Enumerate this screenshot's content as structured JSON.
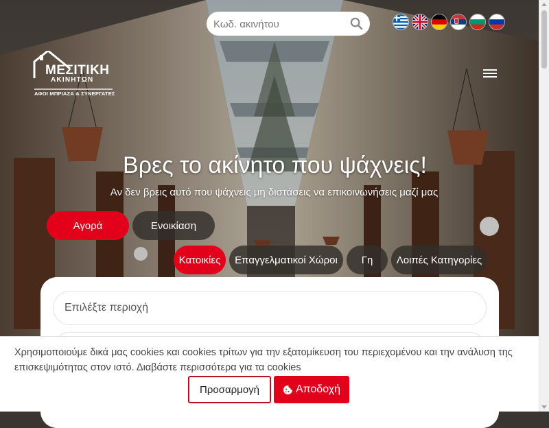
{
  "search": {
    "placeholder": "Κωδ. ακινήτου"
  },
  "languages": [
    {
      "name": "greek-flag-icon"
    },
    {
      "name": "uk-flag-icon"
    },
    {
      "name": "german-flag-icon"
    },
    {
      "name": "serbian-flag-icon"
    },
    {
      "name": "bulgarian-flag-icon"
    },
    {
      "name": "russian-flag-icon"
    }
  ],
  "logo": {
    "line1": "ΜΕΣΙΤΙΚΗ",
    "line2": "ΑΚΙΝΗΤΩΝ",
    "line3": "ΑΦΟΙ ΜΠΡΙΑΖΑ & ΣΥΝΕΡΓΑΤΕΣ"
  },
  "hero": {
    "title": "Βρες το ακίνητο που ψάχνεις!",
    "subtitle": "Αν δεν βρεις αυτό που ψάχνεις μη διστάσεις να επικοινωνήσεις μαζί μας"
  },
  "tabs": {
    "buy": "Αγορά",
    "rent": "Ενοικίαση"
  },
  "categories": {
    "homes": "Κατοικίες",
    "professional": "Επαγγελματικοί Χώροι",
    "land": "Γη",
    "other": "Λοιπές Κατηγορίες"
  },
  "filter": {
    "area_placeholder": "Επιλέξτε περιοχή"
  },
  "cookie": {
    "text": "Χρησιμοποιούμε δικά μας cookies και cookies τρίτων για την εξατομίκευση του περιεχομένου και την ανάλυση της επισκεψιμότητας στον ιστό.",
    "link": "Διαβάστε περισσότερα για τα cookies",
    "customize": "Προσαρμογή",
    "accept": "Αποδοχή"
  },
  "colors": {
    "accent": "#e3001b",
    "pill_dark": "#322e2a"
  }
}
